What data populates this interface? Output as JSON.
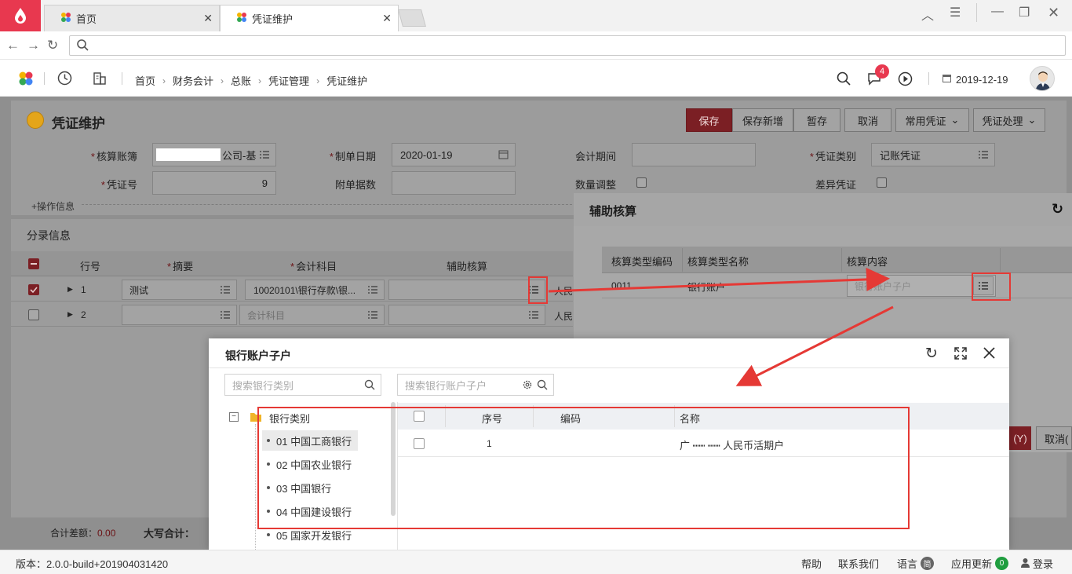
{
  "browser": {
    "tabs": [
      {
        "label": "首页",
        "active": false
      },
      {
        "label": "凭证维护",
        "active": true
      }
    ],
    "url": ""
  },
  "header": {
    "breadcrumb": [
      "首页",
      "财务会计",
      "总账",
      "凭证管理",
      "凭证维护"
    ],
    "notification_count": "4",
    "date": "2019-12-19"
  },
  "page": {
    "title": "凭证维护",
    "toolbar": {
      "save": "保存",
      "save_new": "保存新增",
      "draft": "暂存",
      "cancel": "取消",
      "common_voucher": "常用凭证",
      "voucher_process": "凭证处理"
    },
    "form": {
      "ledger_label": "核算账簿",
      "ledger_value": "公司-基",
      "date_label": "制单日期",
      "date_value": "2020-01-19",
      "period_label": "会计期间",
      "period_value": "",
      "type_label": "凭证类别",
      "type_value": "记账凭证",
      "number_label": "凭证号",
      "number_value": "9",
      "attach_label": "附单据数",
      "attach_value": "",
      "qty_label": "数量调整",
      "diff_label": "差异凭证",
      "ops_info": "+操作信息"
    },
    "entries": {
      "section_title": "分录信息",
      "columns": {
        "row_no": "行号",
        "summary": "摘要",
        "account": "会计科目",
        "aux": "辅助核算",
        "currency": "人民"
      },
      "rows": [
        {
          "no": "1",
          "summary": "测试",
          "account": "10020101\\银行存款\\银...",
          "currency": "人民",
          "checked": true
        },
        {
          "no": "2",
          "summary": "",
          "account": "会计科目",
          "currency": "人民",
          "checked": false
        }
      ]
    },
    "footer": {
      "diff_label": "合计差额：",
      "diff_value": "0.00",
      "capital_label": "大写合计："
    }
  },
  "aux_dialog": {
    "title": "辅助核算",
    "columns": [
      "核算类型编码",
      "核算类型名称",
      "核算内容"
    ],
    "row": {
      "code": "0011",
      "name": "银行账户",
      "content_placeholder": "银行账户子户"
    },
    "confirm_label": "(Y)",
    "cancel_label": "取消("
  },
  "bank_dialog": {
    "title": "银行账户子户",
    "category_search_placeholder": "搜索银行类别",
    "account_search_placeholder": "搜索银行账户子户",
    "tree_root": "银行类别",
    "tree_items": [
      "01 中国工商银行",
      "02 中国农业银行",
      "03 中国银行",
      "04 中国建设银行",
      "05 国家开发银行"
    ],
    "table_columns": {
      "seq": "序号",
      "code": "编码",
      "name": "名称"
    },
    "rows": [
      {
        "seq": "1",
        "code": "",
        "name": "广  ┉┉   ┉┉   人民币活期户"
      }
    ]
  },
  "statusbar": {
    "version": "版本：2.0.0-build+201904031420",
    "help": "帮助",
    "contact": "联系我们",
    "language": "语言",
    "language_badge": "简",
    "update": "应用更新",
    "update_count": "0",
    "login": "登录"
  }
}
